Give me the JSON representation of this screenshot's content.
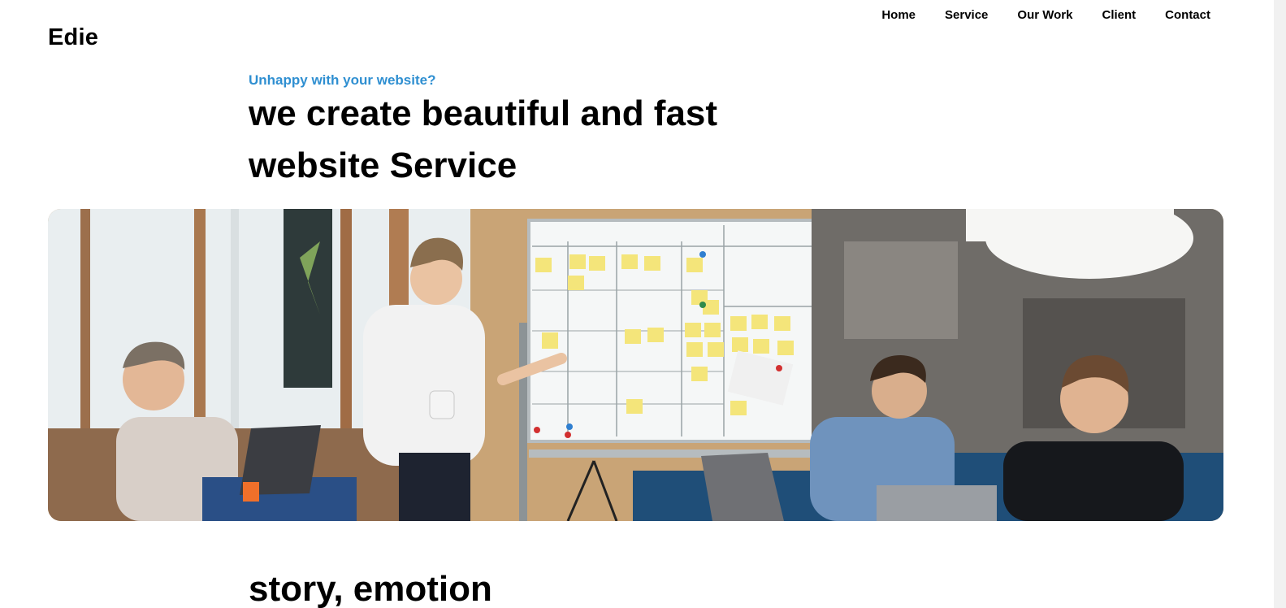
{
  "brand": {
    "name": "Edie"
  },
  "nav": {
    "items": [
      {
        "label": "Home"
      },
      {
        "label": "Service"
      },
      {
        "label": "Our Work"
      },
      {
        "label": "Client"
      },
      {
        "label": "Contact"
      }
    ]
  },
  "hero": {
    "eyebrow": "Unhappy with your website?",
    "headline": "we create beautiful and fast website Service",
    "image_icon": "team-meeting-photo"
  },
  "section": {
    "title": "story, emotion"
  },
  "colors": {
    "accent": "#2f8fd1",
    "text": "#000000",
    "background": "#ffffff"
  }
}
